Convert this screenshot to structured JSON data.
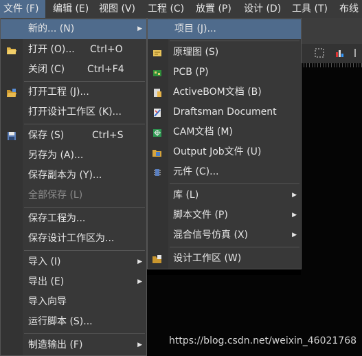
{
  "menubar": {
    "items": [
      {
        "label": "文件 (F)"
      },
      {
        "label": "编辑 (E)"
      },
      {
        "label": "视图 (V)"
      },
      {
        "label": "工程 (C)"
      },
      {
        "label": "放置 (P)"
      },
      {
        "label": "设计 (D)"
      },
      {
        "label": "工具 (T)"
      },
      {
        "label": "布线"
      }
    ]
  },
  "file_menu": {
    "items": [
      {
        "label": "新的... (N)",
        "shortcut": "",
        "submenu": true
      },
      {
        "label": "打开 (O)...",
        "shortcut": "Ctrl+O"
      },
      {
        "label": "关闭 (C)",
        "shortcut": "Ctrl+F4"
      },
      {
        "label": "打开工程 (J)..."
      },
      {
        "label": "打开设计工作区 (K)..."
      },
      {
        "label": "保存 (S)",
        "shortcut": "Ctrl+S"
      },
      {
        "label": "另存为 (A)..."
      },
      {
        "label": "保存副本为 (Y)..."
      },
      {
        "label": "全部保存 (L)"
      },
      {
        "label": "保存工程为..."
      },
      {
        "label": "保存设计工作区为..."
      },
      {
        "label": "导入 (I)"
      },
      {
        "label": "导出 (E)"
      },
      {
        "label": "导入向导"
      },
      {
        "label": "运行脚本 (S)..."
      },
      {
        "label": "制造输出 (F)"
      }
    ]
  },
  "new_submenu": {
    "items": [
      {
        "label": "项目 (J)..."
      },
      {
        "label": "原理图 (S)",
        "icon": "schematic-icon"
      },
      {
        "label": "PCB (P)",
        "icon": "pcb-icon"
      },
      {
        "label": "ActiveBOM文档 (B)",
        "icon": "activebom-icon"
      },
      {
        "label": "Draftsman Document",
        "icon": "draftsman-icon"
      },
      {
        "label": "CAM文档 (M)",
        "icon": "cam-icon"
      },
      {
        "label": "Output Job文件 (U)",
        "icon": "output-job-icon"
      },
      {
        "label": "元件 (C)...",
        "icon": "component-icon"
      },
      {
        "label": "库 (L)"
      },
      {
        "label": "脚本文件 (P)"
      },
      {
        "label": "混合信号仿真 (X)"
      },
      {
        "label": "设计工作区 (W)",
        "icon": "workspace-icon"
      }
    ]
  },
  "watermark": "https://blog.csdn.net/weixin_46021768",
  "colors": {
    "menu_bg": "#383838",
    "highlight": "#4f6b8c",
    "canvas": "#050505"
  }
}
